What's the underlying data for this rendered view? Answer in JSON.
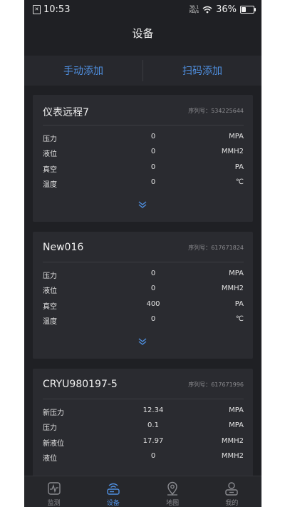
{
  "status": {
    "time": "10:53",
    "speed_top": "38.1",
    "speed_bottom": "KB/s",
    "battery": "36%",
    "battery_level": 0.36
  },
  "header": {
    "title": "设备"
  },
  "add_bar": {
    "manual": "手动添加",
    "scan": "扫码添加"
  },
  "serial_label": "序列号：",
  "devices": [
    {
      "name": "仪表远程7",
      "serial": "534225644",
      "rows": [
        {
          "label": "压力",
          "value": "0",
          "unit": "MPA"
        },
        {
          "label": "液位",
          "value": "0",
          "unit": "MMH2"
        },
        {
          "label": "真空",
          "value": "0",
          "unit": "PA"
        },
        {
          "label": "温度",
          "value": "0",
          "unit": "℃"
        }
      ]
    },
    {
      "name": "New016",
      "serial": "617671824",
      "rows": [
        {
          "label": "压力",
          "value": "0",
          "unit": "MPA"
        },
        {
          "label": "液位",
          "value": "0",
          "unit": "MMH2"
        },
        {
          "label": "真空",
          "value": "400",
          "unit": "PA"
        },
        {
          "label": "温度",
          "value": "0",
          "unit": "℃"
        }
      ]
    },
    {
      "name": "CRYU980197-5",
      "serial": "617671996",
      "rows": [
        {
          "label": "新压力",
          "value": "12.34",
          "unit": "MPA"
        },
        {
          "label": "压力",
          "value": "0.1",
          "unit": "MPA"
        },
        {
          "label": "新液位",
          "value": "17.97",
          "unit": "MMH2"
        },
        {
          "label": "液位",
          "value": "0",
          "unit": "MMH2"
        }
      ]
    }
  ],
  "tabs": [
    {
      "label": "监测",
      "icon": "monitor-icon"
    },
    {
      "label": "设备",
      "icon": "device-icon",
      "active": true
    },
    {
      "label": "地图",
      "icon": "map-pin-icon"
    },
    {
      "label": "我的",
      "icon": "user-icon"
    }
  ],
  "colors": {
    "accent": "#4f8fe0",
    "background": "#1f2024",
    "card": "#2a2b30"
  }
}
